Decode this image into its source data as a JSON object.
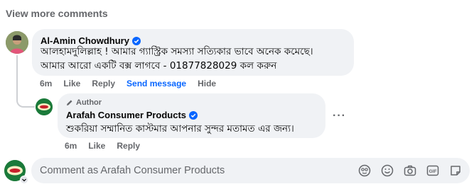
{
  "view_more_label": "View more comments",
  "comment1": {
    "author": "Al-Amin Chowdhury",
    "line1": "আলহামদুলিল্লাহ ! আমার গ্যাস্ট্রিক সমস্যা সত্যিকার ভাবে অনেক কমেছে।",
    "line2": "আমার আরো একটি বক্স লাগবে - 01877828029 কল করুন",
    "time": "6m",
    "like_label": "Like",
    "reply_label": "Reply",
    "send_message_label": "Send message",
    "hide_label": "Hide"
  },
  "reply1": {
    "author_badge": "Author",
    "author": "Arafah Consumer Products",
    "text": "শুকরিয়া সম্মানিত কাস্টমার আপনার সুন্দর মতামত এর জন্য।",
    "time": "6m",
    "like_label": "Like",
    "reply_label": "Reply",
    "more_label": "···"
  },
  "composer": {
    "placeholder": "Comment as Arafah Consumer Products",
    "icons": [
      "sticker-icon",
      "emoji-icon",
      "camera-icon",
      "gif-icon",
      "more-icon"
    ]
  },
  "colors": {
    "accent": "#0866ff",
    "secondary_text": "#65676b",
    "bubble_bg": "#f0f2f5",
    "brand_green": "#1b7a3a"
  }
}
